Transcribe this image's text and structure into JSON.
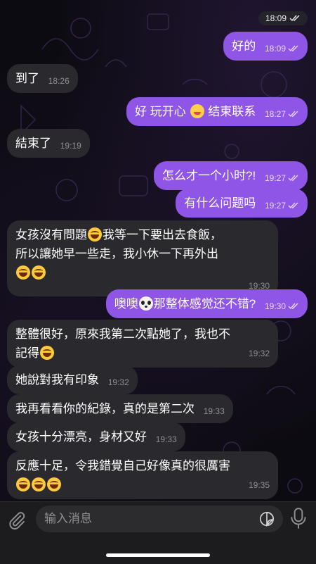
{
  "status": {
    "time": "18:09"
  },
  "messages": [
    {
      "id": "m1",
      "dir": "out",
      "text": "好的",
      "time": "18:09"
    },
    {
      "id": "m2",
      "dir": "in",
      "text": "到了",
      "time": "18:26"
    },
    {
      "id": "m3",
      "dir": "out",
      "text_a": "好 玩开心",
      "emoji": "wink-face",
      "text_b": "结束联系",
      "time": "18:27"
    },
    {
      "id": "m4",
      "dir": "in",
      "text": "結束了",
      "time": "19:19"
    },
    {
      "id": "m5",
      "dir": "out",
      "text": "怎么才一个小时?!",
      "time": "19:27"
    },
    {
      "id": "m6",
      "dir": "out",
      "text": "有什么问题吗",
      "time": "19:27"
    },
    {
      "id": "m7",
      "dir": "in",
      "line1_a": "女孩沒有問題",
      "emoji": "laughing-tears",
      "line1_b": "我等一下要出去食飯，",
      "line2": "所以讓她早一些走，我小休一下再外出",
      "time": "19:30"
    },
    {
      "id": "m8",
      "dir": "out",
      "text_a": "噢噢",
      "emoji": "panda-face",
      "text_b": "那整体感觉还不错?",
      "time": "19:30"
    },
    {
      "id": "m9",
      "dir": "in",
      "line1": "整體很好，原來我第二次點她了，我也不",
      "line2": "記得",
      "time": "19:32"
    },
    {
      "id": "m10",
      "dir": "in",
      "text": "她說對我有印象",
      "time": "19:32"
    },
    {
      "id": "m11",
      "dir": "in",
      "text": "我再看看你的紀錄，真的是第二次",
      "time": "19:33"
    },
    {
      "id": "m12",
      "dir": "in",
      "text": "女孩十分漂亮，身材又好",
      "time": "19:33"
    },
    {
      "id": "m13",
      "dir": "in",
      "line1": "反應十足，令我錯覺自己好像真的很厲害",
      "time": "19:35"
    }
  ],
  "composer": {
    "placeholder": "输入消息"
  },
  "icons": {
    "attach": "paperclip-icon",
    "sticker": "sticker-icon",
    "mic": "microphone-icon",
    "read": "double-check-icon"
  },
  "colors": {
    "outgoing_bubble": "#8f55e6",
    "incoming_bubble": "#2a2a2e",
    "background": "#0d0b12"
  }
}
